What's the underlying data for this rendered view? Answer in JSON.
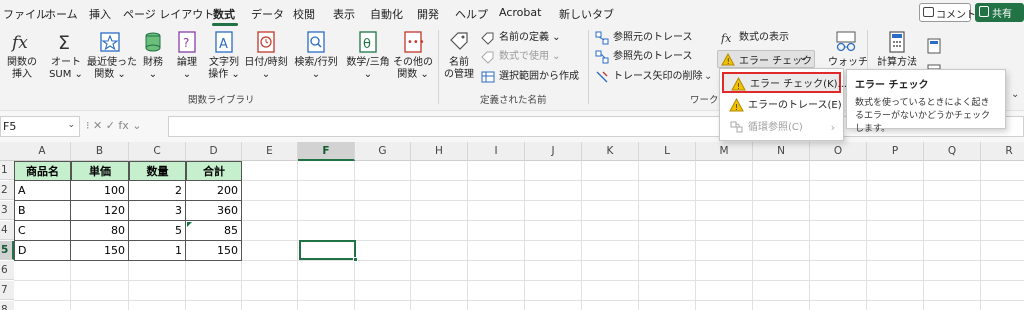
{
  "tabs": [
    {
      "label": "ファイル"
    },
    {
      "label": "ホーム"
    },
    {
      "label": "挿入"
    },
    {
      "label": "ページ レイアウト"
    },
    {
      "label": "数式"
    },
    {
      "label": "データ"
    },
    {
      "label": "校閲"
    },
    {
      "label": "表示"
    },
    {
      "label": "自動化"
    },
    {
      "label": "開発"
    },
    {
      "label": "ヘルプ"
    },
    {
      "label": "Acrobat"
    },
    {
      "label": "新しいタブ"
    }
  ],
  "active_tab": "数式",
  "top_buttons": {
    "comment": "コメント",
    "share": "共有"
  },
  "ribbon": {
    "function_library": {
      "group_label": "関数ライブラリ",
      "insert_function": {
        "line1": "関数の",
        "line2": "挿入"
      },
      "autosum": {
        "line1": "オート",
        "line2": "SUM ⌄"
      },
      "recent": {
        "line1": "最近使った",
        "line2": "関数 ⌄"
      },
      "financial": {
        "line1": "財務",
        "line2": "⌄"
      },
      "logical": {
        "line1": "論理",
        "line2": "⌄"
      },
      "text": {
        "line1": "文字列",
        "line2": "操作 ⌄"
      },
      "datetime": {
        "line1": "日付/時刻",
        "line2": "⌄"
      },
      "lookup": {
        "line1": "検索/行列",
        "line2": "⌄"
      },
      "math": {
        "line1": "数学/三角",
        "line2": "⌄"
      },
      "more": {
        "line1": "その他の",
        "line2": "関数 ⌄"
      }
    },
    "defined_names": {
      "group_label": "定義された名前",
      "name_manager": {
        "line1": "名前",
        "line2": "の管理"
      },
      "define_name": "名前の定義  ⌄",
      "use_in_formula": "数式で使用  ⌄",
      "create_from_selection": "選択範囲から作成"
    },
    "formula_auditing": {
      "group_label": "ワーク",
      "trace_precedents": "参照元のトレース",
      "trace_dependents": "参照先のトレース",
      "remove_arrows": "トレース矢印の削除",
      "remove_arrows_caret": "⌄",
      "show_formulas": "数式の表示",
      "error_checking": "エラー チェック",
      "error_checking_caret": "⌄",
      "watch": "ウォッチ"
    },
    "calculation": {
      "calc_options": "計算方法"
    }
  },
  "formula_bar": {
    "name_box": "F5",
    "name_box_caret": "⌄",
    "controls": "⁝   ✕  ✓  fx ⌄",
    "formula": ""
  },
  "columns": [
    "A",
    "B",
    "C",
    "D",
    "E",
    "F",
    "G",
    "H",
    "I",
    "J",
    "K",
    "L",
    "M",
    "N",
    "O",
    "P",
    "Q",
    "R"
  ],
  "rows": [
    "1",
    "2",
    "3",
    "4",
    "5",
    "6",
    "7",
    "8"
  ],
  "selected_cell": "F5",
  "table": {
    "headers": [
      "商品名",
      "単価",
      "数量",
      "合計"
    ],
    "rows": [
      [
        "A",
        "100",
        "2",
        "200"
      ],
      [
        "B",
        "120",
        "3",
        "360"
      ],
      [
        "C",
        "80",
        "5",
        "85"
      ],
      [
        "D",
        "150",
        "1",
        "150"
      ]
    ]
  },
  "error_menu": {
    "items": [
      {
        "label": "エラー チェック(K)...",
        "state": "highlighted"
      },
      {
        "label": "エラーのトレース(E)",
        "state": "normal"
      },
      {
        "label": "循環参照(C)",
        "state": "disabled",
        "arrow": "›"
      }
    ]
  },
  "tooltip": {
    "title": "エラー チェック",
    "body": "数式を使っているときによく起きるエラーがないかどうかチェックします。"
  },
  "colors": {
    "accent_green": "#217346",
    "header_fill": "#c6efce",
    "highlight_border": "#e02a2a",
    "warning_yellow": "#f2c200"
  }
}
